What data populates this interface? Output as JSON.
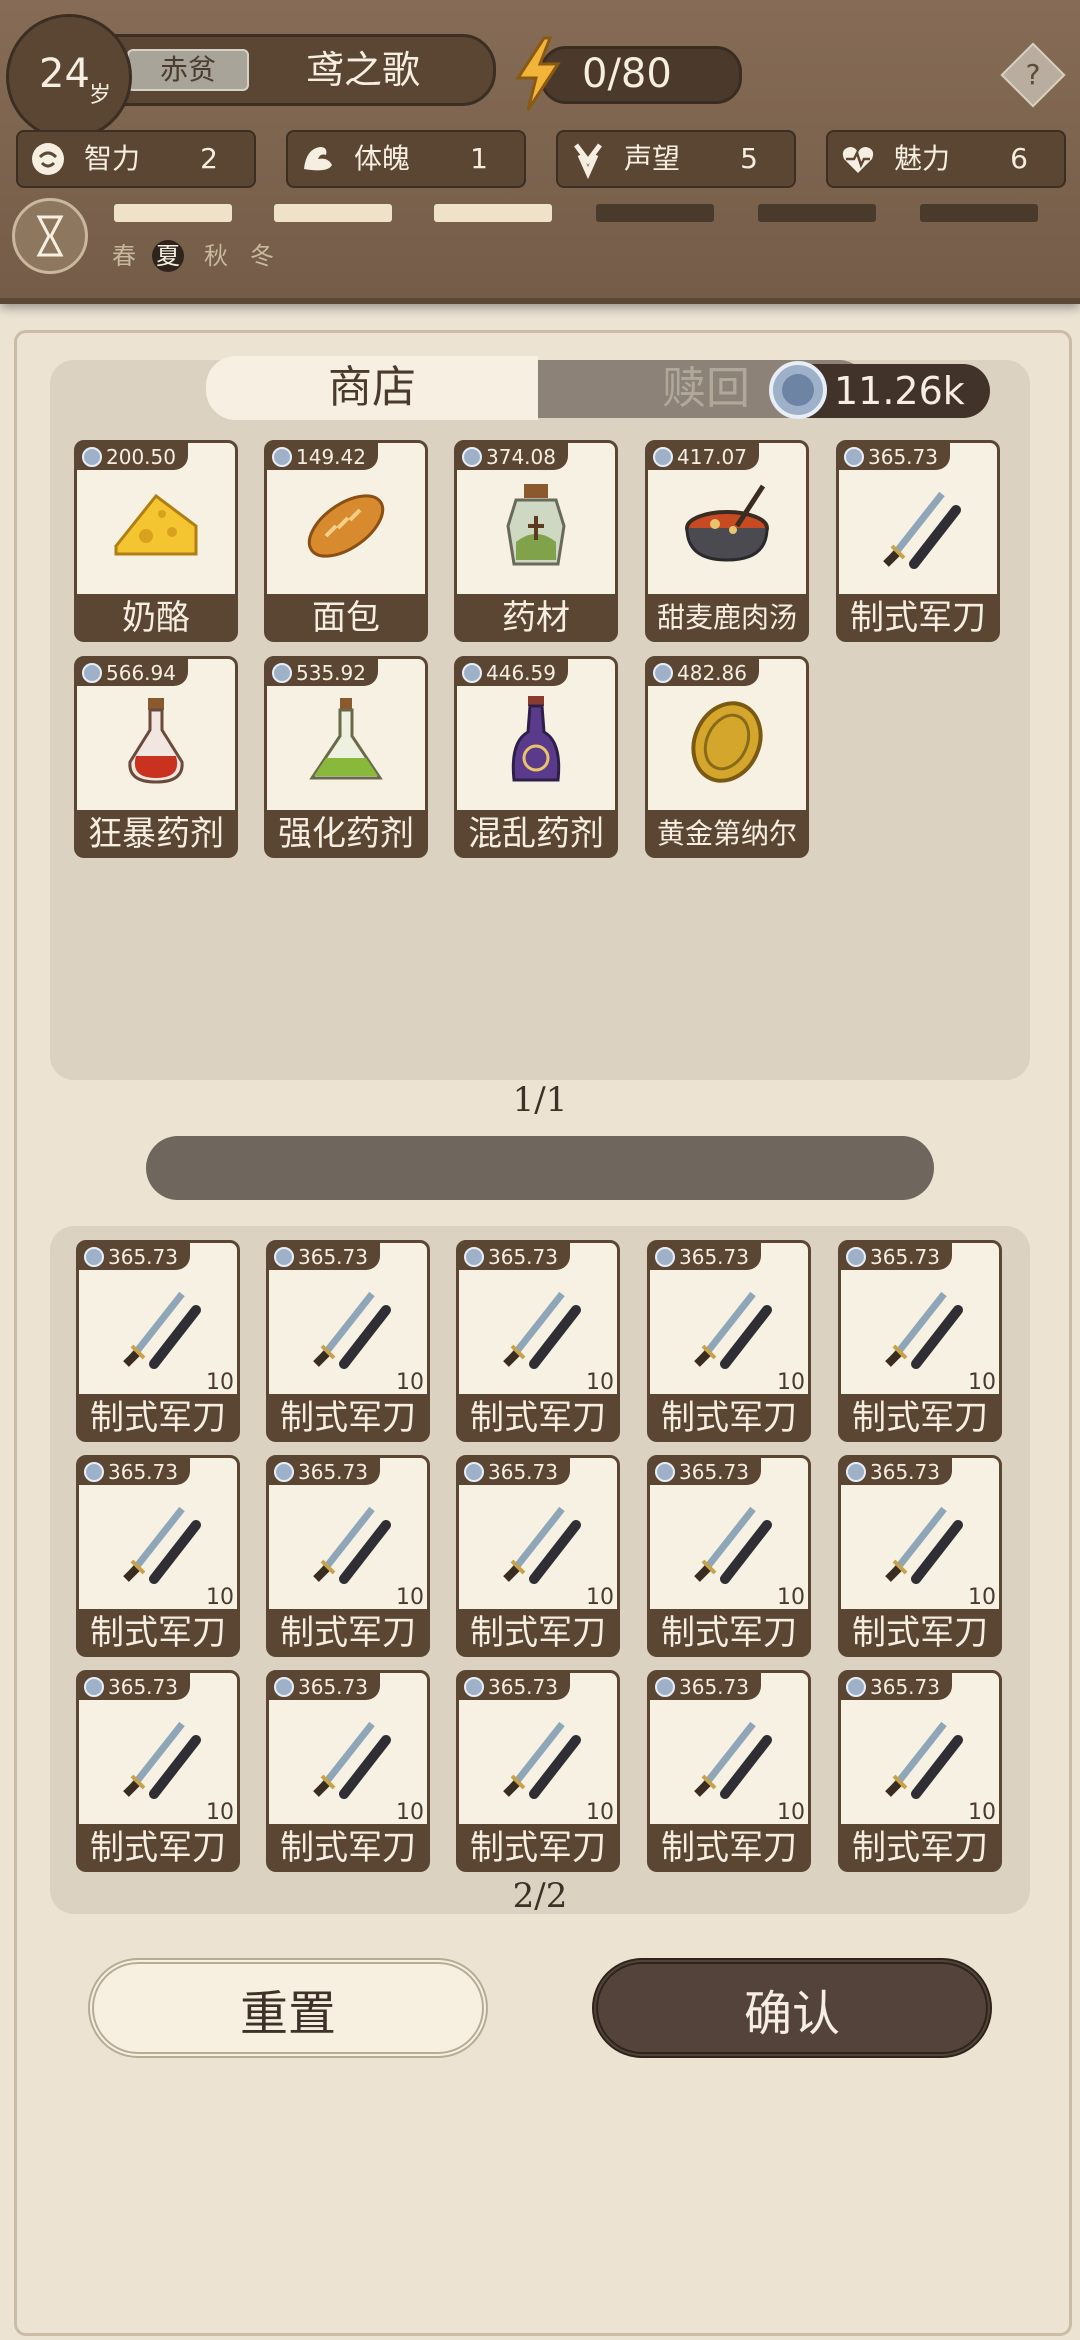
{
  "header": {
    "age": "24",
    "age_unit": "岁",
    "status": "赤贫",
    "name": "鸢之歌",
    "energy": "0/80",
    "help": "?"
  },
  "attributes": [
    {
      "label": "智力",
      "value": "2",
      "icon": "brain-icon"
    },
    {
      "label": "体魄",
      "value": "1",
      "icon": "muscle-icon"
    },
    {
      "label": "声望",
      "value": "5",
      "icon": "laurel-icon"
    },
    {
      "label": "魅力",
      "value": "6",
      "icon": "heart-icon"
    }
  ],
  "seasons": [
    "春",
    "夏",
    "秋",
    "冬"
  ],
  "active_season": "夏",
  "tabs": {
    "shop": "商店",
    "redeem": "赎回"
  },
  "currency": "11.26k",
  "shop_items": [
    {
      "price": "200.50",
      "name": "奶酪",
      "icon": "cheese-icon"
    },
    {
      "price": "149.42",
      "name": "面包",
      "icon": "bread-icon"
    },
    {
      "price": "374.08",
      "name": "药材",
      "icon": "herb-jar-icon"
    },
    {
      "price": "417.07",
      "name": "甜麦鹿肉汤",
      "icon": "stew-pot-icon"
    },
    {
      "price": "365.73",
      "name": "制式军刀",
      "icon": "saber-icon"
    },
    {
      "price": "566.94",
      "name": "狂暴药剂",
      "icon": "red-potion-icon"
    },
    {
      "price": "535.92",
      "name": "强化药剂",
      "icon": "green-potion-icon"
    },
    {
      "price": "446.59",
      "name": "混乱药剂",
      "icon": "purple-potion-icon"
    },
    {
      "price": "482.86",
      "name": "黄金第纳尔",
      "icon": "gold-coin-icon"
    }
  ],
  "shop_page": "1/1",
  "inventory_items": [
    {
      "price": "365.73",
      "name": "制式军刀",
      "count": "10"
    },
    {
      "price": "365.73",
      "name": "制式军刀",
      "count": "10"
    },
    {
      "price": "365.73",
      "name": "制式军刀",
      "count": "10"
    },
    {
      "price": "365.73",
      "name": "制式军刀",
      "count": "10"
    },
    {
      "price": "365.73",
      "name": "制式军刀",
      "count": "10"
    },
    {
      "price": "365.73",
      "name": "制式军刀",
      "count": "10"
    },
    {
      "price": "365.73",
      "name": "制式军刀",
      "count": "10"
    },
    {
      "price": "365.73",
      "name": "制式军刀",
      "count": "10"
    },
    {
      "price": "365.73",
      "name": "制式军刀",
      "count": "10"
    },
    {
      "price": "365.73",
      "name": "制式军刀",
      "count": "10"
    },
    {
      "price": "365.73",
      "name": "制式军刀",
      "count": "10"
    },
    {
      "price": "365.73",
      "name": "制式军刀",
      "count": "10"
    },
    {
      "price": "365.73",
      "name": "制式军刀",
      "count": "10"
    },
    {
      "price": "365.73",
      "name": "制式军刀",
      "count": "10"
    },
    {
      "price": "365.73",
      "name": "制式军刀",
      "count": "10"
    }
  ],
  "inventory_page": "2/2",
  "buttons": {
    "reset": "重置",
    "confirm": "确认"
  }
}
